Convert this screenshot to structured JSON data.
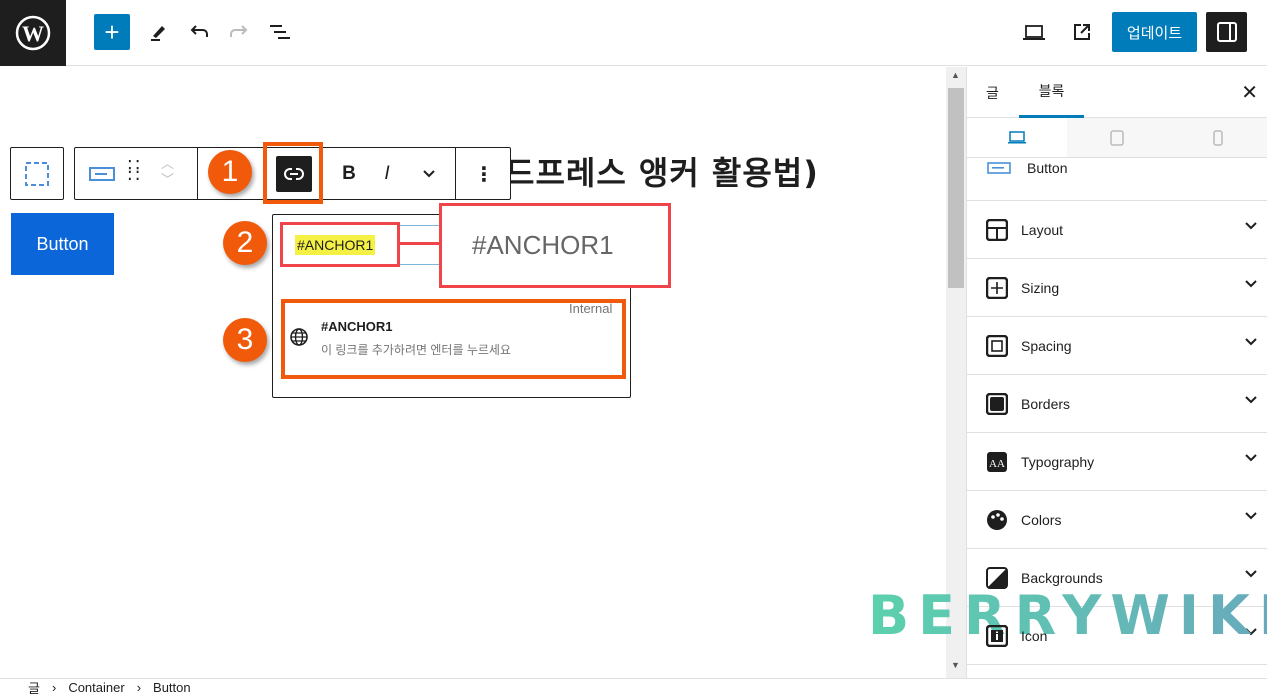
{
  "topbar": {
    "update_label": "업데이트"
  },
  "editor": {
    "heading_visible": "드프레스 앵커 활용법)",
    "button_label": "Button",
    "toolbar": {
      "bold": "B",
      "italic": "I"
    },
    "link_popover": {
      "input_value": "#ANCHOR1",
      "callout_value": "#ANCHOR1",
      "suggestion_title": "#ANCHOR1",
      "suggestion_hint": "이 링크를 추가하려면 엔터를 누르세요",
      "suggestion_type": "Internal"
    },
    "annotations": [
      "1",
      "2",
      "3"
    ],
    "annotation_color": "#f05a0a"
  },
  "sidebar": {
    "tabs": [
      {
        "label": "글"
      },
      {
        "label": "블록",
        "active": true
      }
    ],
    "block_name": "Button",
    "panels": [
      {
        "label": "Layout",
        "icon": "layout-icon"
      },
      {
        "label": "Sizing",
        "icon": "sizing-icon"
      },
      {
        "label": "Spacing",
        "icon": "spacing-icon"
      },
      {
        "label": "Borders",
        "icon": "borders-icon"
      },
      {
        "label": "Typography",
        "icon": "typography-icon"
      },
      {
        "label": "Colors",
        "icon": "colors-icon"
      },
      {
        "label": "Backgrounds",
        "icon": "backgrounds-icon"
      },
      {
        "label": "Icon",
        "icon": "info-icon"
      }
    ]
  },
  "breadcrumb": {
    "items": [
      "글",
      "Container",
      "Button"
    ],
    "separator": "›"
  },
  "watermark": "BERRYWIKI",
  "colors": {
    "accent": "#007cba",
    "button": "#0a66d9",
    "highlight": "#f5f044"
  }
}
